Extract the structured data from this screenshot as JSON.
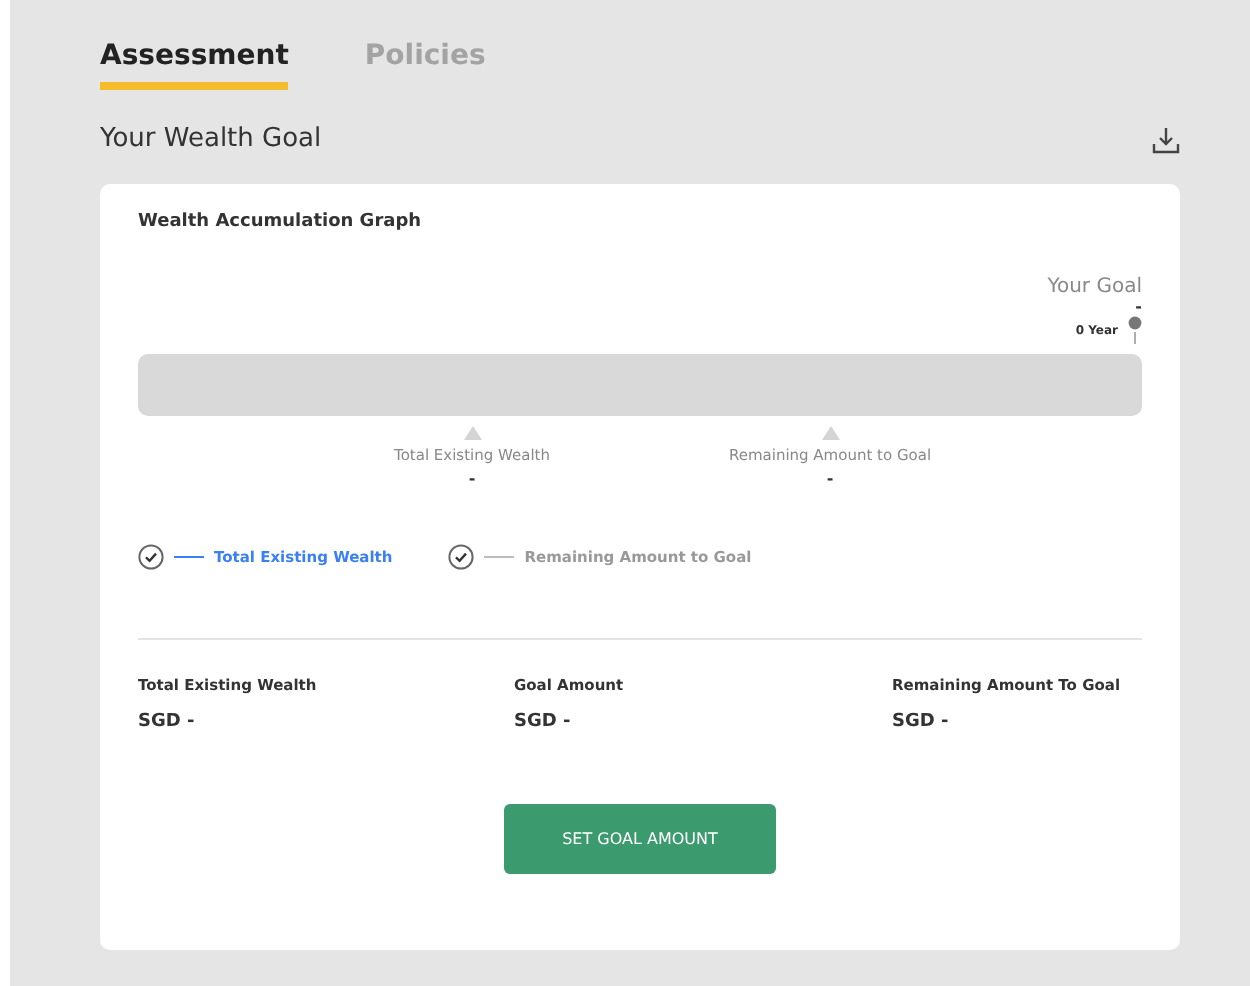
{
  "tabs": [
    {
      "label": "Assessment",
      "selected": true
    },
    {
      "label": "Policies",
      "selected": false
    }
  ],
  "section_title": "Your Wealth Goal",
  "card": {
    "title": "Wealth Accumulation Graph",
    "goal": {
      "label": "Your Goal",
      "value": "-",
      "year": "0 Year"
    },
    "markers": [
      {
        "label": "Total Existing Wealth",
        "value": "-"
      },
      {
        "label": "Remaining Amount to Goal",
        "value": "-"
      }
    ],
    "legend": [
      {
        "label": "Total Existing Wealth",
        "checked": true,
        "color": "#3b7ff5"
      },
      {
        "label": "Remaining Amount to Goal",
        "checked": true,
        "color": "#bdbdbd"
      }
    ],
    "summary": [
      {
        "label": "Total Existing Wealth",
        "value": "SGD -"
      },
      {
        "label": "Goal Amount",
        "value": "SGD -"
      },
      {
        "label": "Remaining Amount To Goal",
        "value": "SGD -"
      }
    ],
    "button": "SET GOAL AMOUNT"
  }
}
